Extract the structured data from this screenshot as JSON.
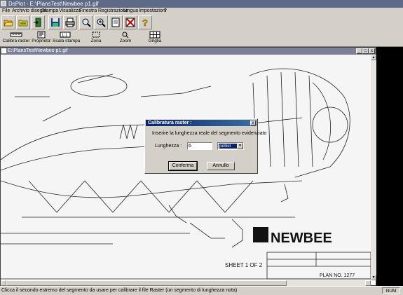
{
  "window": {
    "title": "DsPlot - E:\\PlansTest\\Newbee p1.gif"
  },
  "menu": [
    "File",
    "Archivio disegni",
    "Stampa",
    "Visualizza",
    "Finestra",
    "Registrazione",
    "Lingua",
    "Impostazioni",
    "?"
  ],
  "toolbar": {
    "labels": {
      "calibrate": "Calibra raster",
      "properties": "Proprieta'",
      "print_scale": "Scala stampa",
      "zone": "Zona",
      "zoom": "Zoom",
      "grid": "Griglia"
    },
    "icons": [
      "open-folder-icon",
      "folder-icon",
      "exit-door-icon",
      "save-disk-icon",
      "printer-icon",
      "zoom-magnifier-icon",
      "zoom-area-icon",
      "page-icon",
      "close-x-icon",
      "help-icon"
    ]
  },
  "document": {
    "title": "E:\\PlansTest\\Newbee p1.gif",
    "plan_text": {
      "logo": "NEWBEE",
      "sheet": "SHEET 1 OF 2",
      "plan_no": "PLAN NO. 1277"
    }
  },
  "dialog": {
    "title": "Calibratura raster :",
    "instruction": "Inserire la lunghezza reale del segmento evidenziato",
    "length_label": "Lunghezza :",
    "length_value": "6",
    "unit_value": "pollici",
    "ok_label": "Conferma",
    "cancel_label": "Annullo"
  },
  "status": {
    "message": "Clicca il secondo estremo del segmento da usare per calibrare il file Raster (un segmento di lunghezza nota)",
    "num_indicator": "NUM"
  },
  "colors": {
    "titlebar": "#5f6a86",
    "dialog_title": "#0a246a",
    "face": "#d4d0c8"
  }
}
